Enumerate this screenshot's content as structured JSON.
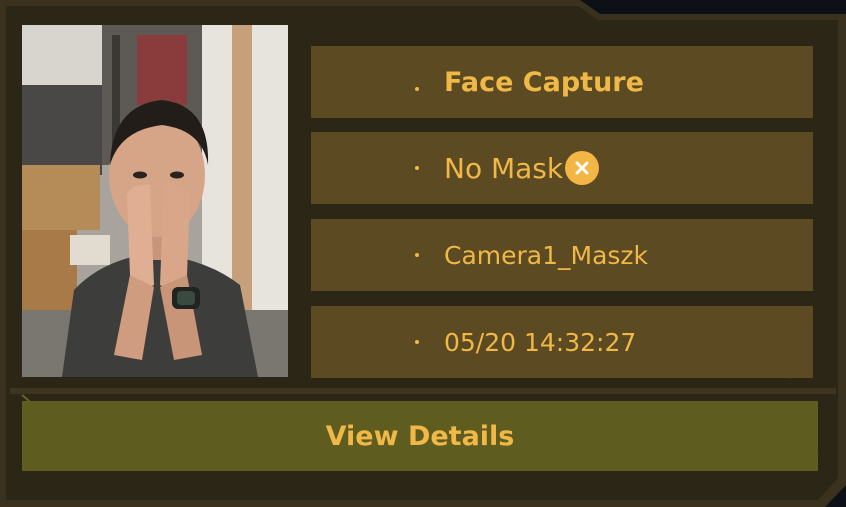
{
  "card": {
    "title": "Face Capture",
    "mask_status": "No Mask",
    "camera": "Camera1_Maszk",
    "timestamp": "05/20 14:32:27",
    "details_label": "View Details"
  },
  "icons": {
    "status": "close-circle-icon",
    "photo": "face-capture-photo"
  },
  "colors": {
    "accent": "#f0b846",
    "row_background": "#5c4a22",
    "button_background": "#5f5c20",
    "frame": "#2b2416"
  }
}
